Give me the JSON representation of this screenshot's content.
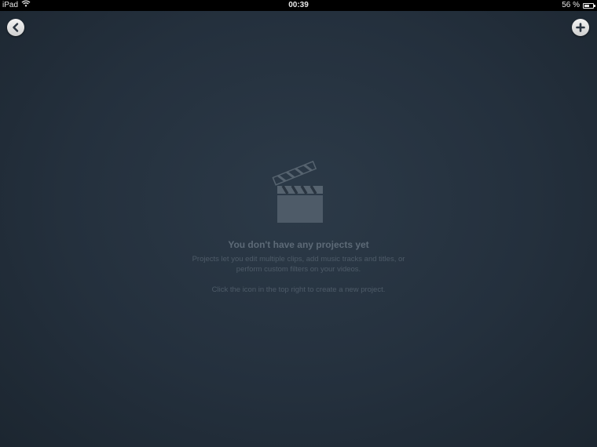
{
  "status_bar": {
    "device": "iPad",
    "time": "00:39",
    "battery_percent": "56 %",
    "battery_level": 0.56,
    "wifi_icon": "wifi-icon",
    "battery_icon": "battery-icon"
  },
  "toolbar": {
    "back_icon": "chevron-left-icon",
    "add_icon": "plus-icon"
  },
  "empty_state": {
    "icon": "clapperboard-icon",
    "title": "You don't have any projects yet",
    "description": "Projects let you edit multiple clips, add music tracks and titles, or perform custom filters on your videos.",
    "hint": "Click the icon in the top right to create a new project."
  },
  "colors": {
    "background": "#26323f",
    "text_muted": "#5d6a77",
    "button": "#e6e6e6"
  }
}
